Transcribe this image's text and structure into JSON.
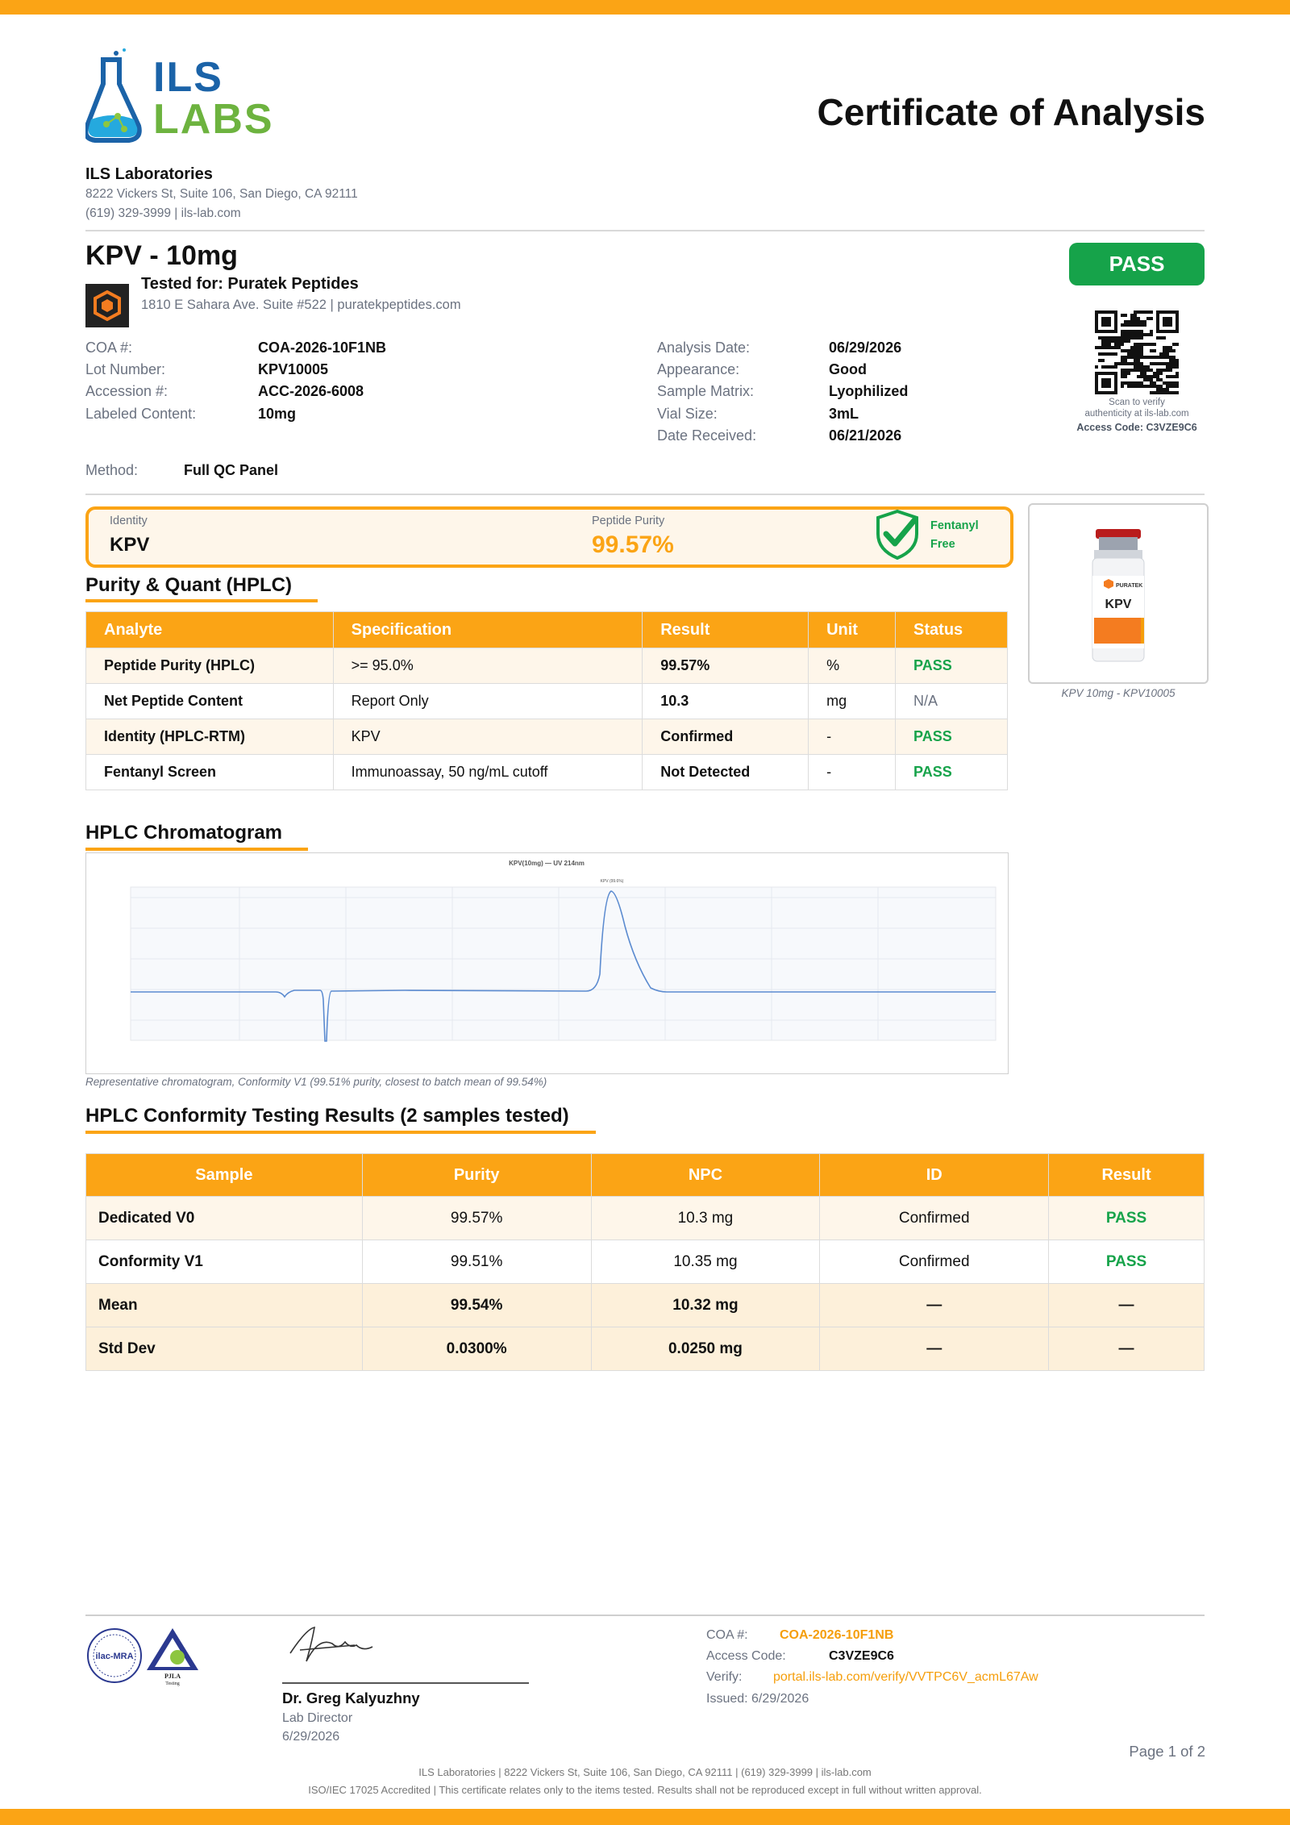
{
  "header": {
    "logo_top": "ILS",
    "logo_bottom": "LABS",
    "title": "Certificate of Analysis",
    "lab_name": "ILS Laboratories",
    "lab_address": "8222 Vickers St, Suite 106, San Diego, CA 92111",
    "lab_contact": "(619) 329-3999  |  ils-lab.com"
  },
  "product": {
    "name": "KPV - 10mg",
    "tested_for": "Tested for: Puratek Peptides",
    "client_address": "1810 E Sahara Ave. Suite #522  |  puratekpeptides.com",
    "status": "PASS"
  },
  "qr": {
    "caption_1": "Scan to verify",
    "caption_2": "authenticity at ils-lab.com",
    "access_code": "Access Code: C3VZE9C6"
  },
  "details_left": [
    {
      "label": "COA #:",
      "value": "COA-2026-10F1NB"
    },
    {
      "label": "Lot Number:",
      "value": "KPV10005"
    },
    {
      "label": "Accession #:",
      "value": "ACC-2026-6008"
    },
    {
      "label": "Labeled Content:",
      "value": "10mg"
    }
  ],
  "details_right": [
    {
      "label": "Analysis Date:",
      "value": "06/29/2026"
    },
    {
      "label": "Appearance:",
      "value": "Good"
    },
    {
      "label": "Sample Matrix:",
      "value": "Lyophilized"
    },
    {
      "label": "Vial Size:",
      "value": "3mL"
    },
    {
      "label": "Date Received:",
      "value": "06/21/2026"
    }
  ],
  "method": {
    "label": "Method:",
    "value": "Full QC Panel"
  },
  "highlight": {
    "identity_label": "Identity",
    "identity_value": "KPV",
    "purity_label": "Peptide Purity",
    "purity_value": "99.57%",
    "fentanyl_1": "Fentanyl",
    "fentanyl_2": "Free"
  },
  "vial": {
    "caption": "KPV 10mg - KPV10005",
    "brand": "PURATEK",
    "label": "KPV"
  },
  "purity_section": {
    "title": "Purity & Quant (HPLC)",
    "headers": [
      "Analyte",
      "Specification",
      "Result",
      "Unit",
      "Status"
    ],
    "rows": [
      {
        "analyte": "Peptide Purity (HPLC)",
        "spec": ">= 95.0%",
        "result": "99.57%",
        "unit": "%",
        "status": "PASS"
      },
      {
        "analyte": "Net Peptide Content",
        "spec": "Report Only",
        "result": "10.3",
        "unit": "mg",
        "status": "N/A"
      },
      {
        "analyte": "Identity (HPLC-RTM)",
        "spec": "KPV",
        "result": "Confirmed",
        "unit": "-",
        "status": "PASS"
      },
      {
        "analyte": "Fentanyl Screen",
        "spec": "Immunoassay, 50 ng/mL cutoff",
        "result": "Not Detected",
        "unit": "-",
        "status": "PASS"
      }
    ]
  },
  "chromatogram": {
    "title": "HPLC Chromatogram",
    "plot_title": "KPV(10mg) — UV 214nm",
    "peak_label": "KPV (99.6%)",
    "caption": "Representative chromatogram, Conformity V1 (99.51% purity, closest to batch mean of 99.54%)"
  },
  "conformity": {
    "title": "HPLC Conformity Testing Results (2 samples tested)",
    "headers": [
      "Sample",
      "Purity",
      "NPC",
      "ID",
      "Result"
    ],
    "rows": [
      {
        "sample": "Dedicated V0",
        "purity": "99.57%",
        "npc": "10.3 mg",
        "id": "Confirmed",
        "result": "PASS"
      },
      {
        "sample": "Conformity V1",
        "purity": "99.51%",
        "npc": "10.35 mg",
        "id": "Confirmed",
        "result": "PASS"
      },
      {
        "sample": "Mean",
        "purity": "99.54%",
        "npc": "10.32 mg",
        "id": "—",
        "result": "—"
      },
      {
        "sample": "Std Dev",
        "purity": "0.0300%",
        "npc": "0.0250 mg",
        "id": "—",
        "result": "—"
      }
    ]
  },
  "footer": {
    "seal_1": "ilac-MRA",
    "seal_2": "PJLA",
    "seal_2_sub": "Testing",
    "signer_name": "Dr. Greg Kalyuzhny",
    "signer_title": "Lab Director",
    "signed_date": "6/29/2026",
    "coa_label": "COA #:",
    "coa_value": "COA-2026-10F1NB",
    "access_label": "Access Code:",
    "access_value": "C3VZE9C6",
    "verify_label": "Verify:",
    "verify_value": "portal.ils-lab.com/verify/VVTPC6V_acmL67Aw",
    "issued": "Issued: 6/29/2026",
    "page": "Page 1 of 2",
    "line_1": "ILS Laboratories  |  8222 Vickers St, Suite 106, San Diego, CA 92111  |  (619) 329-3999  |  ils-lab.com",
    "line_2": "ISO/IEC 17025 Accredited  |  This certificate relates only to the items tested. Results shall not be reproduced except in full without written approval."
  }
}
